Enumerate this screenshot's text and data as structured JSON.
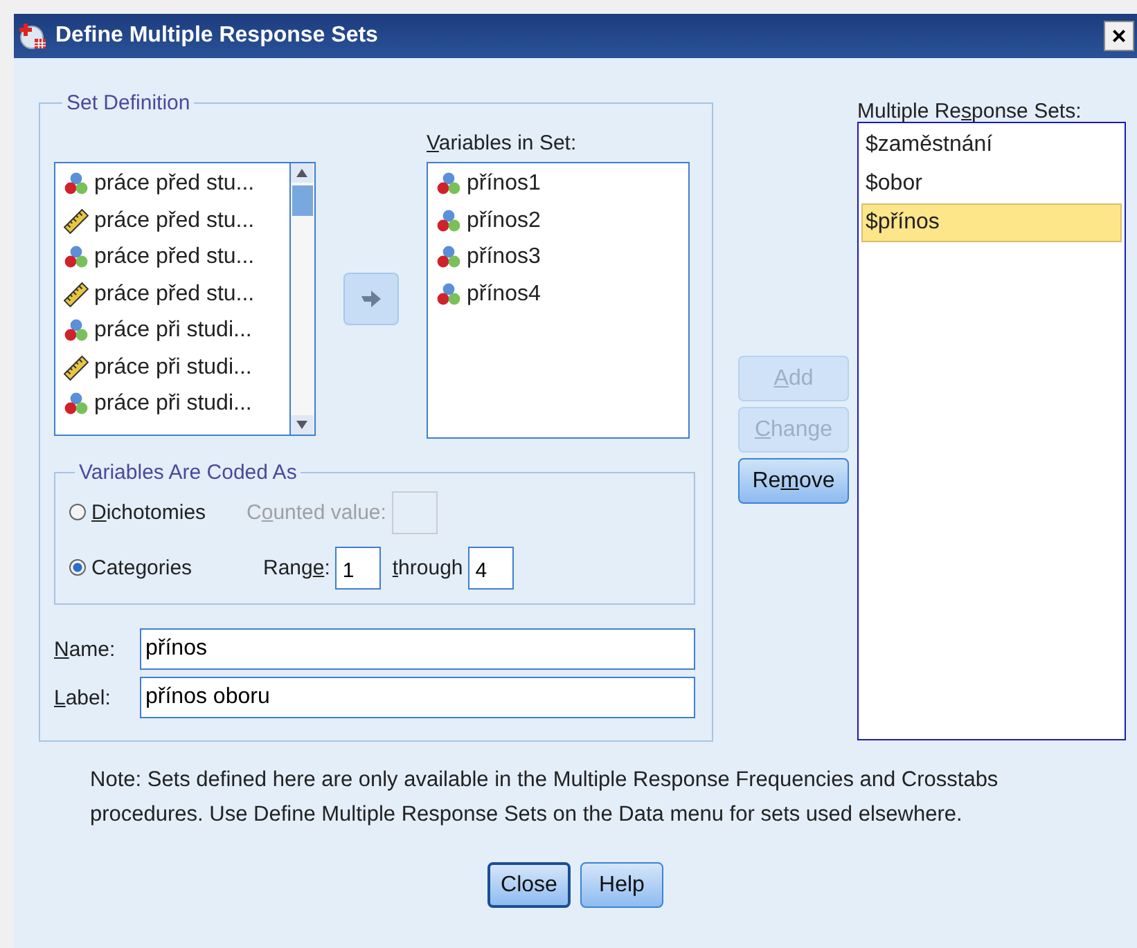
{
  "window": {
    "title": "Define Multiple Response Sets",
    "close": "×"
  },
  "set_definition": {
    "title": "Set Definition",
    "variables": [
      {
        "name": "práce před stu...",
        "kind": "nominal"
      },
      {
        "name": "práce před stu...",
        "kind": "scale"
      },
      {
        "name": "práce před stu...",
        "kind": "nominal"
      },
      {
        "name": "práce před stu...",
        "kind": "scale"
      },
      {
        "name": "práce při studi...",
        "kind": "nominal"
      },
      {
        "name": "práce při studi...",
        "kind": "scale"
      },
      {
        "name": "práce při studi...",
        "kind": "nominal"
      }
    ],
    "variables_in_set": {
      "label": "Variables in Set:",
      "items": [
        {
          "name": "přínos1",
          "kind": "nominal"
        },
        {
          "name": "přínos2",
          "kind": "nominal"
        },
        {
          "name": "přínos3",
          "kind": "nominal"
        },
        {
          "name": "přínos4",
          "kind": "nominal"
        }
      ]
    },
    "coded_as": {
      "title": "Variables Are Coded As",
      "options": [
        {
          "label": "Dichotomies",
          "selected": false
        },
        {
          "label": "Categories",
          "selected": true
        }
      ],
      "counted_value": {
        "label": "Counted value:",
        "disabled": true
      },
      "range": {
        "label": "Range:",
        "from": "1",
        "through_label": "through",
        "to": "4"
      }
    },
    "name": {
      "label": "Name:",
      "value": "přínos"
    },
    "label": {
      "label": "Label:",
      "value": "přínos oboru"
    }
  },
  "buttons": [
    {
      "label": "Add",
      "disabled": true
    },
    {
      "label": "Change",
      "disabled": true
    },
    {
      "label": "Remove",
      "disabled": false
    }
  ],
  "response_sets": {
    "label": "Multiple Response Sets:",
    "items": [
      {
        "name": "$zaměstnání",
        "selected": false
      },
      {
        "name": "$obor",
        "selected": false
      },
      {
        "name": "$přínos",
        "selected": true
      }
    ]
  },
  "note": "Note: Sets defined here are only available in the Multiple Response Frequencies and Crosstabs procedures. Use Define Multiple Response Sets on the Data menu for sets used elsewhere.",
  "footer_buttons": [
    {
      "label": "Close",
      "default": true
    },
    {
      "label": "Help",
      "default": false
    }
  ]
}
